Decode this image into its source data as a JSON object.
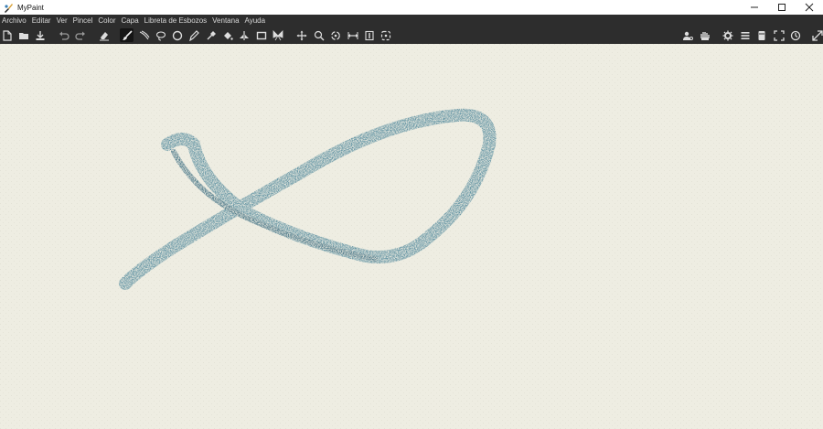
{
  "window": {
    "title": "MyPaint"
  },
  "menu": [
    "Archivo",
    "Editar",
    "Ver",
    "Pincel",
    "Color",
    "Capa",
    "Libreta de Esbozos",
    "Ventana",
    "Ayuda"
  ],
  "toolbar": {
    "left_tools": [
      "new-icon",
      "open-icon",
      "save-icon",
      "undo-icon",
      "redo-icon",
      "eraser-icon",
      "brush-icon",
      "inking-icon",
      "lasso-icon",
      "ellipse-icon",
      "pen-icon",
      "color-picker-icon",
      "fill-icon",
      "symmetry-icon",
      "frame-icon",
      "butterfly-icon",
      "pan-icon",
      "zoom-icon",
      "rotate-icon",
      "flip-icon",
      "mirror-icon",
      "reset-view-icon"
    ],
    "active_tool": "brush-icon",
    "right_tools": [
      "layers-props-icon",
      "hand-icon",
      "settings-icon",
      "menu-icon",
      "layers-icon",
      "fullscreen-icon",
      "history-icon",
      "expand-icon"
    ]
  },
  "colors": {
    "stroke": "#5b8fa0",
    "stroke_dark": "#3f6f82",
    "canvas": "#eeede2",
    "toolbar": "#2d2d2d"
  }
}
